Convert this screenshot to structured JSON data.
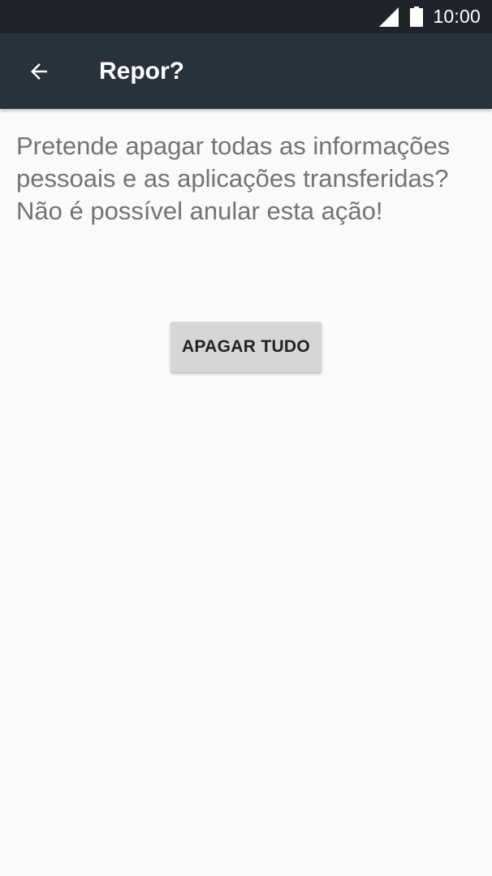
{
  "status_bar": {
    "time": "10:00",
    "icons": [
      "cellular-signal-icon",
      "battery-icon"
    ]
  },
  "app_bar": {
    "back_icon": "arrow-left-icon",
    "title": "Repor?"
  },
  "content": {
    "message": "Pretende apagar todas as informações pessoais e as aplicações transferidas? Não é possível anular esta ação!",
    "erase_button_label": "APAGAR TUDO"
  },
  "colors": {
    "status_bar_bg": "#1e2429",
    "app_bar_bg": "#28323b",
    "page_bg": "#fafafa",
    "message_text": "#737373",
    "button_bg": "#d6d6d6"
  }
}
